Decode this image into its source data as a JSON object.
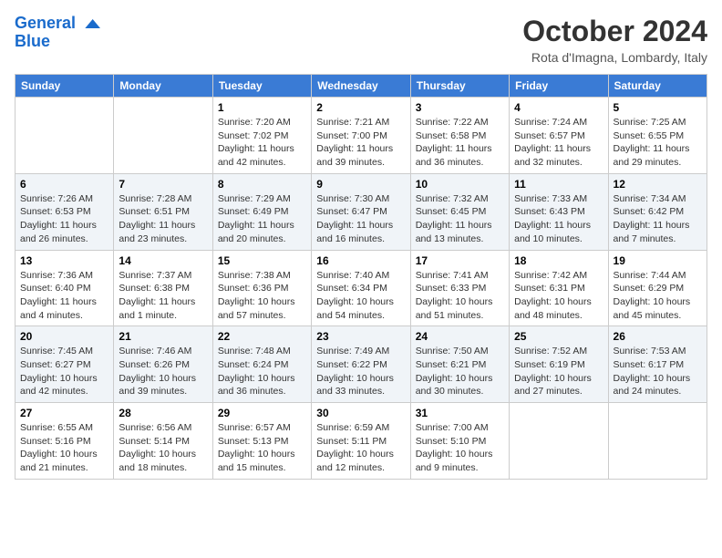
{
  "header": {
    "logo_line1": "General",
    "logo_line2": "Blue",
    "month_year": "October 2024",
    "location": "Rota d'Imagna, Lombardy, Italy"
  },
  "weekdays": [
    "Sunday",
    "Monday",
    "Tuesday",
    "Wednesday",
    "Thursday",
    "Friday",
    "Saturday"
  ],
  "weeks": [
    [
      {
        "day": "",
        "info": ""
      },
      {
        "day": "",
        "info": ""
      },
      {
        "day": "1",
        "info": "Sunrise: 7:20 AM\nSunset: 7:02 PM\nDaylight: 11 hours and 42 minutes."
      },
      {
        "day": "2",
        "info": "Sunrise: 7:21 AM\nSunset: 7:00 PM\nDaylight: 11 hours and 39 minutes."
      },
      {
        "day": "3",
        "info": "Sunrise: 7:22 AM\nSunset: 6:58 PM\nDaylight: 11 hours and 36 minutes."
      },
      {
        "day": "4",
        "info": "Sunrise: 7:24 AM\nSunset: 6:57 PM\nDaylight: 11 hours and 32 minutes."
      },
      {
        "day": "5",
        "info": "Sunrise: 7:25 AM\nSunset: 6:55 PM\nDaylight: 11 hours and 29 minutes."
      }
    ],
    [
      {
        "day": "6",
        "info": "Sunrise: 7:26 AM\nSunset: 6:53 PM\nDaylight: 11 hours and 26 minutes."
      },
      {
        "day": "7",
        "info": "Sunrise: 7:28 AM\nSunset: 6:51 PM\nDaylight: 11 hours and 23 minutes."
      },
      {
        "day": "8",
        "info": "Sunrise: 7:29 AM\nSunset: 6:49 PM\nDaylight: 11 hours and 20 minutes."
      },
      {
        "day": "9",
        "info": "Sunrise: 7:30 AM\nSunset: 6:47 PM\nDaylight: 11 hours and 16 minutes."
      },
      {
        "day": "10",
        "info": "Sunrise: 7:32 AM\nSunset: 6:45 PM\nDaylight: 11 hours and 13 minutes."
      },
      {
        "day": "11",
        "info": "Sunrise: 7:33 AM\nSunset: 6:43 PM\nDaylight: 11 hours and 10 minutes."
      },
      {
        "day": "12",
        "info": "Sunrise: 7:34 AM\nSunset: 6:42 PM\nDaylight: 11 hours and 7 minutes."
      }
    ],
    [
      {
        "day": "13",
        "info": "Sunrise: 7:36 AM\nSunset: 6:40 PM\nDaylight: 11 hours and 4 minutes."
      },
      {
        "day": "14",
        "info": "Sunrise: 7:37 AM\nSunset: 6:38 PM\nDaylight: 11 hours and 1 minute."
      },
      {
        "day": "15",
        "info": "Sunrise: 7:38 AM\nSunset: 6:36 PM\nDaylight: 10 hours and 57 minutes."
      },
      {
        "day": "16",
        "info": "Sunrise: 7:40 AM\nSunset: 6:34 PM\nDaylight: 10 hours and 54 minutes."
      },
      {
        "day": "17",
        "info": "Sunrise: 7:41 AM\nSunset: 6:33 PM\nDaylight: 10 hours and 51 minutes."
      },
      {
        "day": "18",
        "info": "Sunrise: 7:42 AM\nSunset: 6:31 PM\nDaylight: 10 hours and 48 minutes."
      },
      {
        "day": "19",
        "info": "Sunrise: 7:44 AM\nSunset: 6:29 PM\nDaylight: 10 hours and 45 minutes."
      }
    ],
    [
      {
        "day": "20",
        "info": "Sunrise: 7:45 AM\nSunset: 6:27 PM\nDaylight: 10 hours and 42 minutes."
      },
      {
        "day": "21",
        "info": "Sunrise: 7:46 AM\nSunset: 6:26 PM\nDaylight: 10 hours and 39 minutes."
      },
      {
        "day": "22",
        "info": "Sunrise: 7:48 AM\nSunset: 6:24 PM\nDaylight: 10 hours and 36 minutes."
      },
      {
        "day": "23",
        "info": "Sunrise: 7:49 AM\nSunset: 6:22 PM\nDaylight: 10 hours and 33 minutes."
      },
      {
        "day": "24",
        "info": "Sunrise: 7:50 AM\nSunset: 6:21 PM\nDaylight: 10 hours and 30 minutes."
      },
      {
        "day": "25",
        "info": "Sunrise: 7:52 AM\nSunset: 6:19 PM\nDaylight: 10 hours and 27 minutes."
      },
      {
        "day": "26",
        "info": "Sunrise: 7:53 AM\nSunset: 6:17 PM\nDaylight: 10 hours and 24 minutes."
      }
    ],
    [
      {
        "day": "27",
        "info": "Sunrise: 6:55 AM\nSunset: 5:16 PM\nDaylight: 10 hours and 21 minutes."
      },
      {
        "day": "28",
        "info": "Sunrise: 6:56 AM\nSunset: 5:14 PM\nDaylight: 10 hours and 18 minutes."
      },
      {
        "day": "29",
        "info": "Sunrise: 6:57 AM\nSunset: 5:13 PM\nDaylight: 10 hours and 15 minutes."
      },
      {
        "day": "30",
        "info": "Sunrise: 6:59 AM\nSunset: 5:11 PM\nDaylight: 10 hours and 12 minutes."
      },
      {
        "day": "31",
        "info": "Sunrise: 7:00 AM\nSunset: 5:10 PM\nDaylight: 10 hours and 9 minutes."
      },
      {
        "day": "",
        "info": ""
      },
      {
        "day": "",
        "info": ""
      }
    ]
  ]
}
